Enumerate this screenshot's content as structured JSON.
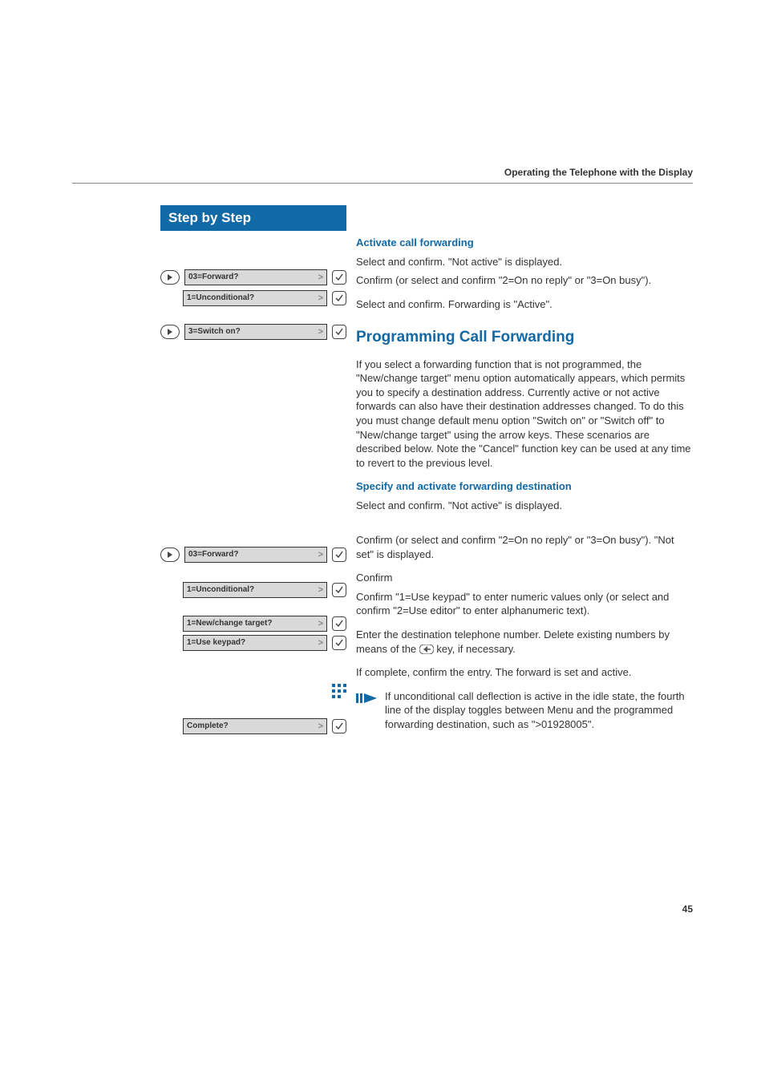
{
  "header": {
    "running_title": "Operating the Telephone with the Display",
    "pagenum": "45"
  },
  "sidebar": {
    "title": "Step by Step"
  },
  "sections": {
    "s1": {
      "header": "Activate call forwarding",
      "rows": {
        "r1": {
          "display": "03=Forward?",
          "body": "Select and confirm. \"Not active\" is displayed."
        },
        "r2": {
          "display": "1=Unconditional?",
          "body": "Confirm (or select and confirm \"2=On no reply\" or \"3=On busy\")."
        },
        "r3": {
          "display": "3=Switch on?",
          "body": "Select and confirm. Forwarding is \"Active\"."
        }
      }
    },
    "s2": {
      "header": "Programming Call Forwarding",
      "intro": "If you select a forwarding function that is not programmed, the \"New/change target\" menu option automatically appears, which permits you to specify a destination address. Currently active or not active forwards can also have their destination addresses changed. To do this you must change default menu option \"Switch on\" or \"Switch off\" to \"New/change target\" using the arrow keys. These scenarios are described below. Note the \"Cancel\" function key can be used at any time to revert to the previous level."
    },
    "s3": {
      "header": "Specify and activate forwarding destination",
      "rows": {
        "r1": {
          "display": "03=Forward?",
          "body": "Select and confirm. \"Not active\" is displayed."
        },
        "r2": {
          "display": "1=Unconditional?",
          "body": "Confirm (or select and confirm \"2=On no reply\" or \"3=On busy\"). \"Not set\" is displayed."
        },
        "r3": {
          "display": "1=New/change target?",
          "body": "Confirm"
        },
        "r4": {
          "display": "1=Use keypad?",
          "body": "Confirm \"1=Use keypad\" to enter numeric values only (or select and confirm \"2=Use editor\" to enter alphanumeric text)."
        },
        "r5": {
          "body_pre": "Enter the destination telephone number. Delete existing numbers by means of the ",
          "body_post": " key, if necessary."
        },
        "r6": {
          "display": "Complete?",
          "body": "If complete, confirm the entry. The forward is set and active."
        }
      },
      "note": "If unconditional call deflection is active in the idle state, the fourth line of the display toggles between Menu and the programmed forwarding destination, such as \">01928005\"."
    }
  }
}
